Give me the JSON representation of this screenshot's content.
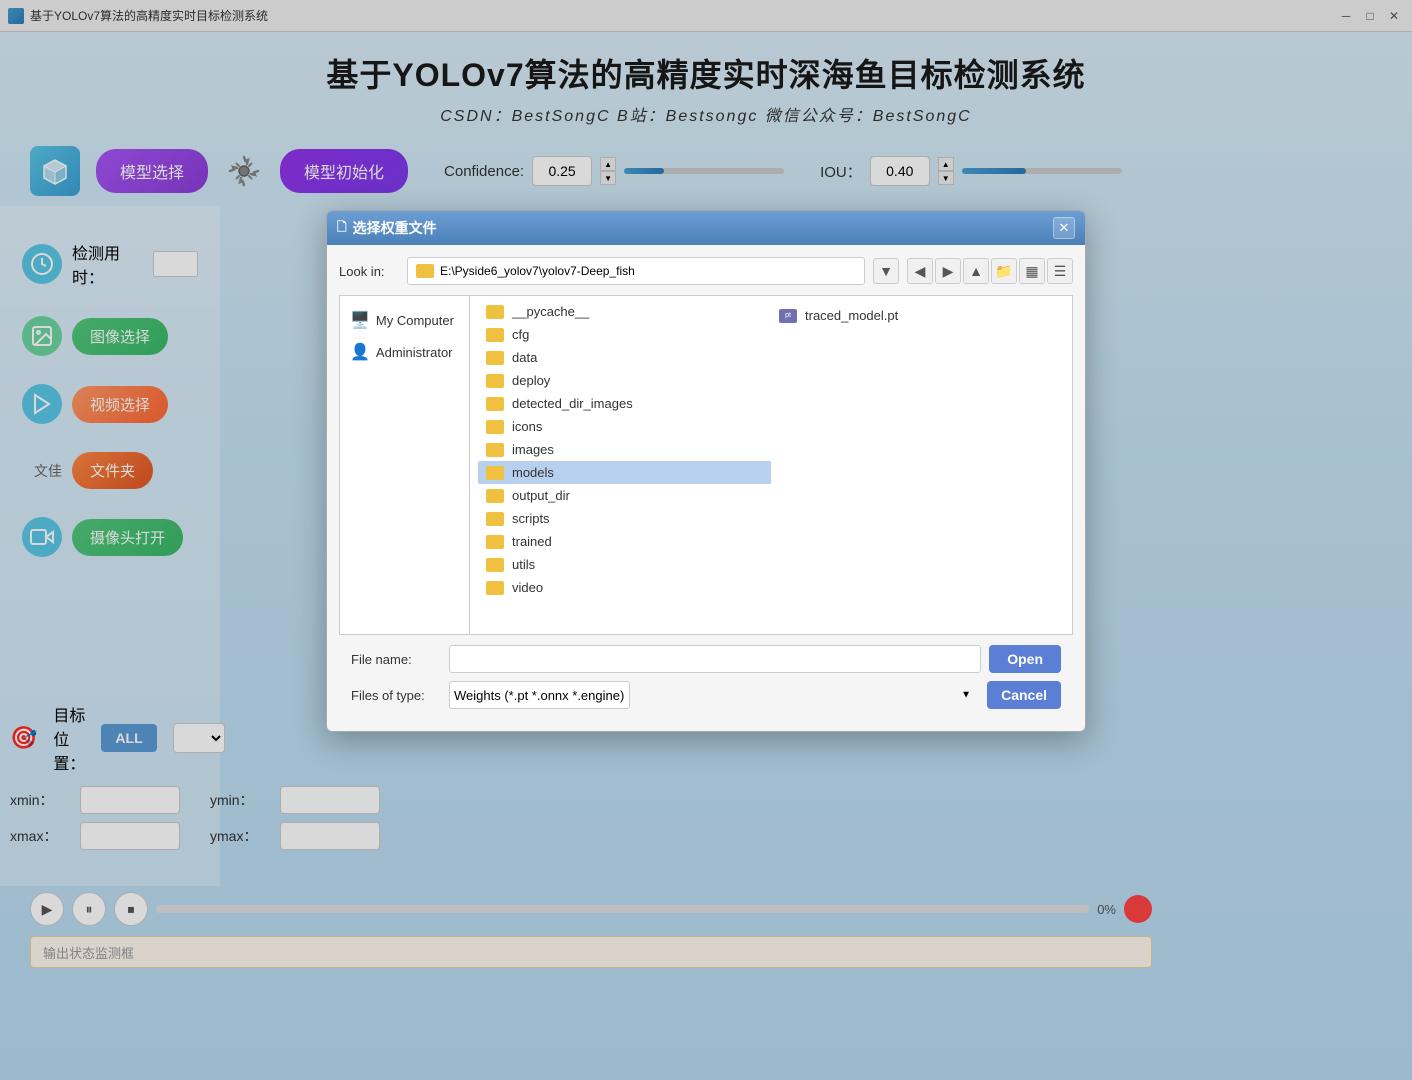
{
  "window": {
    "title": "基于YOLOv7算法的高精度实时目标检测系统",
    "title_bar_text": "基于YOLOv7算法的高精度实时目标检测系统"
  },
  "header": {
    "main_title": "基于YOLOv7算法的高精度实时深海鱼目标检测系统",
    "subtitle": "CSDN：BestSongC  B站：Bestsongc  微信公众号：BestSongC"
  },
  "toolbar": {
    "model_select_label": "模型选择",
    "model_init_label": "模型初始化",
    "confidence_label": "Confidence:",
    "confidence_value": "0.25",
    "iou_label": "IOU：",
    "iou_value": "0.40"
  },
  "sidebar": {
    "detection_time_label": "检测用时：",
    "image_select_label": "图像选择",
    "video_select_label": "视频选择",
    "file_text_label": "文佳",
    "folder_label": "文件夹",
    "camera_label": "摄像头打开"
  },
  "bottom": {
    "target_position_label": "目标位置：",
    "all_btn": "ALL",
    "xmin_label": "xmin：",
    "ymin_label": "ymin：",
    "xmax_label": "xmax：",
    "ymax_label": "ymax：",
    "progress_pct": "0%",
    "status_placeholder": "输出状态监测框"
  },
  "dialog": {
    "title": "选择权重文件",
    "lookin_label": "Look in:",
    "path": "E:\\Pyside6_yolov7\\yolov7-Deep_fish",
    "tree_items": [
      {
        "name": "My Computer",
        "type": "computer"
      },
      {
        "name": "Administrator",
        "type": "user"
      }
    ],
    "files": [
      {
        "name": "__pycache__",
        "type": "folder"
      },
      {
        "name": "cfg",
        "type": "folder"
      },
      {
        "name": "data",
        "type": "folder"
      },
      {
        "name": "deploy",
        "type": "folder"
      },
      {
        "name": "detected_dir_images",
        "type": "folder"
      },
      {
        "name": "icons",
        "type": "folder"
      },
      {
        "name": "images",
        "type": "folder"
      },
      {
        "name": "models",
        "type": "folder",
        "selected": true
      },
      {
        "name": "output_dir",
        "type": "folder"
      },
      {
        "name": "scripts",
        "type": "folder"
      },
      {
        "name": "trained",
        "type": "folder"
      },
      {
        "name": "utils",
        "type": "folder"
      },
      {
        "name": "video",
        "type": "folder"
      }
    ],
    "file_right": {
      "name": "traced_model.pt",
      "type": "file"
    },
    "filename_label": "File name:",
    "filetype_label": "Files of type:",
    "filetype_value": "Weights (*.pt *.onnx *.engine)",
    "open_btn": "Open",
    "cancel_btn": "Cancel"
  }
}
